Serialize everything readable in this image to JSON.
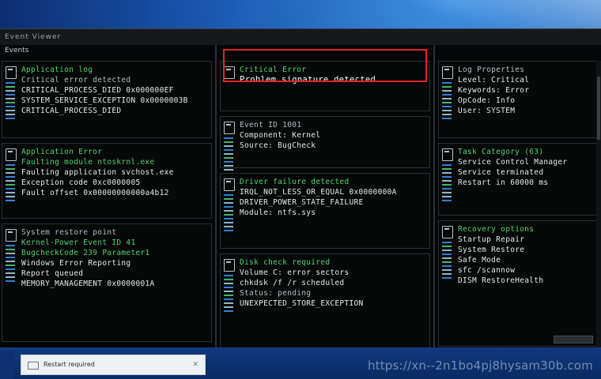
{
  "window": {
    "title": "Event Viewer",
    "left_header": "Events"
  },
  "left_panels": [
    {
      "lines": [
        {
          "t": "Application log",
          "c": "green"
        },
        {
          "t": "Critical error detected",
          "c": "dim"
        },
        {
          "t": "CRITICAL_PROCESS_DIED  0x000000EF",
          "c": ""
        },
        {
          "t": "SYSTEM_SERVICE_EXCEPTION 0x0000003B",
          "c": ""
        },
        {
          "t": "CRITICAL_PROCESS_DIED",
          "c": ""
        }
      ]
    },
    {
      "lines": [
        {
          "t": "Application Error",
          "c": "green"
        },
        {
          "t": "Faulting module ntoskrnl.exe",
          "c": "green"
        },
        {
          "t": "Faulting application svchost.exe",
          "c": ""
        },
        {
          "t": "Exception code 0xc0000005",
          "c": ""
        },
        {
          "t": "Fault offset 0x00000000000a4b12",
          "c": ""
        }
      ]
    },
    {
      "lines": [
        {
          "t": "System restore point",
          "c": "dim"
        },
        {
          "t": "Kernel-Power Event ID 41",
          "c": "green"
        },
        {
          "t": "BugcheckCode 239 Parameter1",
          "c": "green"
        },
        {
          "t": "Windows Error Reporting",
          "c": ""
        },
        {
          "t": "Report queued",
          "c": ""
        },
        {
          "t": "MEMORY_MANAGEMENT  0x0000001A",
          "c": ""
        }
      ]
    }
  ],
  "mid_highlight": {
    "line1": "Critical Error",
    "line2": "Problem signature detected"
  },
  "mid_panels": [
    {
      "lines": [
        {
          "t": "Event ID 1001",
          "c": "dim"
        },
        {
          "t": "Component: Kernel",
          "c": ""
        },
        {
          "t": "Source: BugCheck",
          "c": ""
        }
      ]
    },
    {
      "lines": [
        {
          "t": "Driver failure detected",
          "c": "green"
        },
        {
          "t": "IRQL_NOT_LESS_OR_EQUAL 0x0000000A",
          "c": ""
        },
        {
          "t": "DRIVER_POWER_STATE_FAILURE",
          "c": ""
        },
        {
          "t": "Module: ntfs.sys",
          "c": ""
        }
      ]
    },
    {
      "lines": [
        {
          "t": "Disk check required",
          "c": "green"
        },
        {
          "t": "Volume C: error sectors",
          "c": ""
        },
        {
          "t": "chkdsk /f /r scheduled",
          "c": ""
        },
        {
          "t": "Status: pending",
          "c": "dim"
        },
        {
          "t": "UNEXPECTED_STORE_EXCEPTION",
          "c": ""
        }
      ]
    }
  ],
  "right_panels": [
    {
      "lines": [
        {
          "t": "Log Properties",
          "c": "dim"
        },
        {
          "t": "Level: Critical",
          "c": ""
        },
        {
          "t": "Keywords: Error",
          "c": ""
        },
        {
          "t": "OpCode: Info",
          "c": ""
        },
        {
          "t": "User: SYSTEM",
          "c": ""
        }
      ]
    },
    {
      "lines": [
        {
          "t": "Task Category (63)",
          "c": "green"
        },
        {
          "t": "Service Control Manager",
          "c": ""
        },
        {
          "t": "Service terminated",
          "c": ""
        },
        {
          "t": "Restart in 60000 ms",
          "c": ""
        }
      ]
    },
    {
      "lines": [
        {
          "t": "Recovery options",
          "c": "green"
        },
        {
          "t": "Startup Repair",
          "c": ""
        },
        {
          "t": "System Restore",
          "c": ""
        },
        {
          "t": "Safe Mode",
          "c": ""
        },
        {
          "t": "sfc /scannow",
          "c": ""
        },
        {
          "t": "DISM RestoreHealth",
          "c": ""
        }
      ]
    }
  ],
  "notification": {
    "text": "Restart required"
  },
  "watermark": "https://xn--2n1bo4pj8hysam30b.com"
}
